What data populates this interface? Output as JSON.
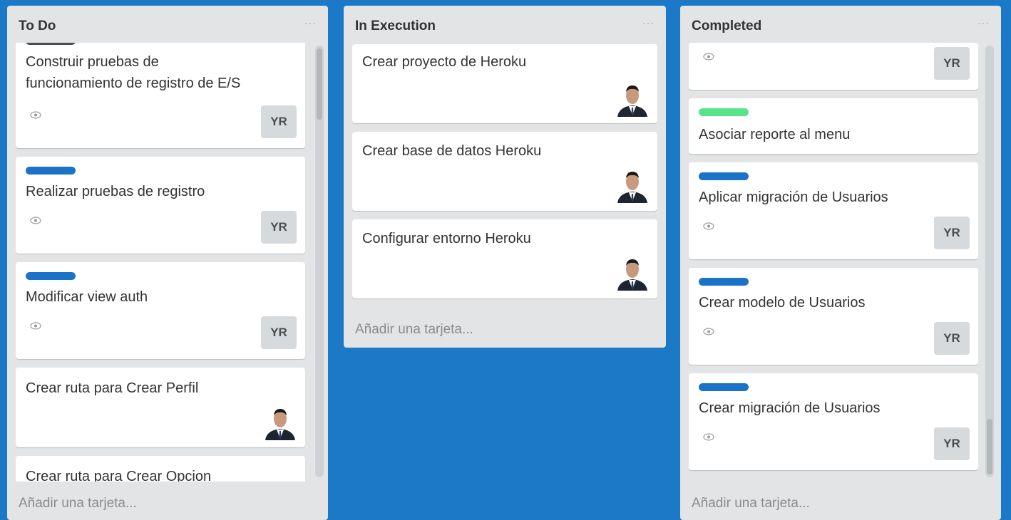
{
  "lists": [
    {
      "title": "To Do",
      "menu": "···",
      "add_card": "Añadir una tarjeta...",
      "cards": [
        {
          "title_lines": [
            "Construir pruebas de",
            "funcionamiento de registro de E/S"
          ],
          "member": "YR"
        },
        {
          "title": "Realizar pruebas de registro",
          "member": "YR",
          "label_color": "#1a73c6"
        },
        {
          "title": "Modificar view auth",
          "member": "YR",
          "label_color": "#1a73c6"
        },
        {
          "title": "Crear ruta para Crear Perfil"
        },
        {
          "title": "Crear ruta para Crear Opcion"
        }
      ]
    },
    {
      "title": "In Execution",
      "menu": "···",
      "add_card": "Añadir una tarjeta...",
      "cards": [
        {
          "title": "Crear proyecto de Heroku"
        },
        {
          "title": "Crear base de datos Heroku"
        },
        {
          "title": "Configurar entorno Heroku"
        }
      ]
    },
    {
      "title": "Completed",
      "menu": "···",
      "add_card": "Añadir una tarjeta...",
      "cards": [
        {
          "member": "YR"
        },
        {
          "title": "Asociar reporte al menu",
          "label_color": "#57e389"
        },
        {
          "title": "Aplicar migración de Usuarios",
          "member": "YR",
          "label_color": "#1a73c6"
        },
        {
          "title": "Crear modelo de Usuarios",
          "member": "YR",
          "label_color": "#1a73c6"
        },
        {
          "title": "Crear migración de Usuarios",
          "member": "YR",
          "label_color": "#1a73c6"
        }
      ]
    }
  ],
  "colors": {
    "board_background": "#1b79c7",
    "list_background": "#e2e4e6",
    "label_blue": "#1a73c6",
    "label_green": "#57e389",
    "label_dark": "#4d4d4d"
  },
  "icons": {
    "watch": "eye-icon",
    "member_photo": "member-avatar-photo"
  }
}
